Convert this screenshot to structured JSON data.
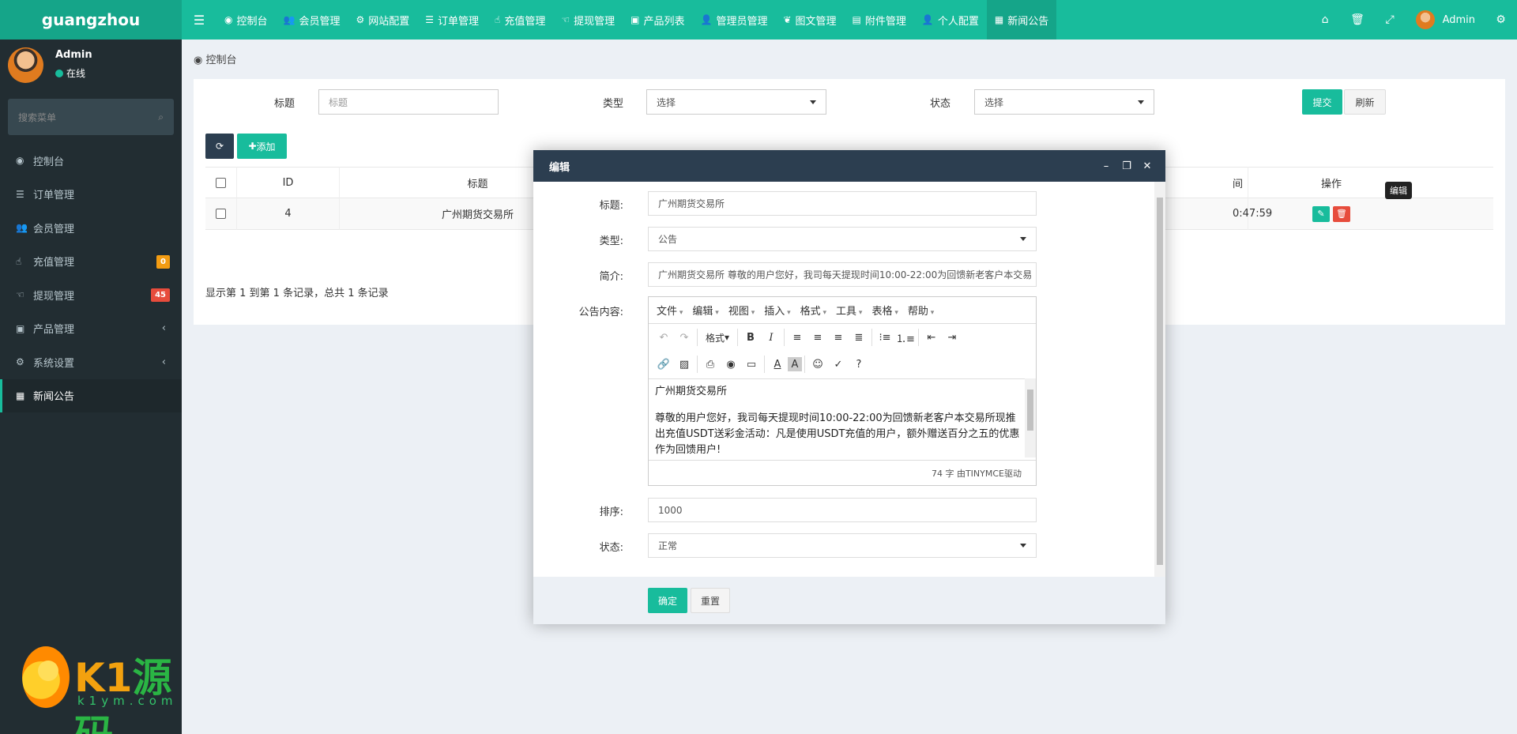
{
  "header": {
    "logo": "guangzhou",
    "nav": [
      {
        "icon": "dashboard-icon",
        "glyph": "◉",
        "label": "控制台"
      },
      {
        "icon": "users-icon",
        "glyph": "👥",
        "label": "会员管理"
      },
      {
        "icon": "gear-icon",
        "glyph": "⚙",
        "label": "网站配置"
      },
      {
        "icon": "list-icon",
        "glyph": "☰",
        "label": "订单管理"
      },
      {
        "icon": "hand-icon",
        "glyph": "☝",
        "label": "充值管理"
      },
      {
        "icon": "hand-left-icon",
        "glyph": "☜",
        "label": "提现管理"
      },
      {
        "icon": "briefcase-icon",
        "glyph": "▣",
        "label": "产品列表"
      },
      {
        "icon": "user-icon",
        "glyph": "👤",
        "label": "管理员管理"
      },
      {
        "icon": "leaf-icon",
        "glyph": "❦",
        "label": "图文管理"
      },
      {
        "icon": "file-icon",
        "glyph": "▤",
        "label": "附件管理"
      },
      {
        "icon": "user-icon",
        "glyph": "👤",
        "label": "个人配置"
      },
      {
        "icon": "newspaper-icon",
        "glyph": "▦",
        "label": "新闻公告"
      }
    ],
    "user": "Admin"
  },
  "sidebar": {
    "username": "Admin",
    "status": "在线",
    "search_placeholder": "搜索菜单",
    "items": [
      {
        "icon": "dashboard-icon",
        "glyph": "◉",
        "label": "控制台"
      },
      {
        "icon": "list-icon",
        "glyph": "☰",
        "label": "订单管理"
      },
      {
        "icon": "users-icon",
        "glyph": "👥",
        "label": "会员管理"
      },
      {
        "icon": "hand-icon",
        "glyph": "☝",
        "label": "充值管理",
        "badge": "0",
        "badge_color": "#f39c12"
      },
      {
        "icon": "hand-left-icon",
        "glyph": "☜",
        "label": "提现管理",
        "badge": "45",
        "badge_color": "#e74c3c"
      },
      {
        "icon": "briefcase-icon",
        "glyph": "▣",
        "label": "产品管理",
        "chevron": "‹"
      },
      {
        "icon": "cogs-icon",
        "glyph": "⚙",
        "label": "系统设置",
        "chevron": "‹"
      },
      {
        "icon": "newspaper-icon",
        "glyph": "▦",
        "label": "新闻公告"
      }
    ]
  },
  "watermark": {
    "brand_a": "K1",
    "brand_b": "源码",
    "site": "k1ym.com"
  },
  "breadcrumb": "控制台",
  "filters": {
    "title_label": "标题",
    "title_placeholder": "标题",
    "type_label": "类型",
    "type_value": "选择",
    "status_label": "状态",
    "status_value": "选择",
    "submit": "提交",
    "reset": "刷新"
  },
  "toolbar": {
    "add": "添加"
  },
  "table": {
    "columns": [
      "ID",
      "标题",
      "间",
      "操作"
    ],
    "rows": [
      {
        "id": "4",
        "title": "广州期货交易所",
        "time": "0:47:59"
      }
    ],
    "tooltip": "编辑"
  },
  "pager": "显示第 1 到第 1 条记录，总共 1 条记录",
  "modal": {
    "title": "编辑",
    "fields": {
      "title_label": "标题:",
      "title_value": "广州期货交易所",
      "type_label": "类型:",
      "type_value": "公告",
      "intro_label": "简介:",
      "intro_value": "广州期货交易所  尊敬的用户您好，我司每天提现时间10:00-22:00为回馈新老客户本交易",
      "content_label": "公告内容:",
      "sort_label": "排序:",
      "sort_value": "1000",
      "status_label": "状态:",
      "status_value": "正常"
    },
    "editor": {
      "menus": [
        "文件",
        "编辑",
        "视图",
        "插入",
        "格式",
        "工具",
        "表格",
        "帮助"
      ],
      "format_label": "格式",
      "content_title": "广州期货交易所",
      "content_body": "尊敬的用户您好，我司每天提现时间10:00-22:00为回馈新老客户本交易所现推出充值USDT送彩金活动：凡是使用USDT充值的用户，额外赠送百分之五的优惠作为回馈用户!",
      "status": "74 字 由TINYMCE驱动"
    },
    "confirm": "确定",
    "reset": "重置"
  }
}
